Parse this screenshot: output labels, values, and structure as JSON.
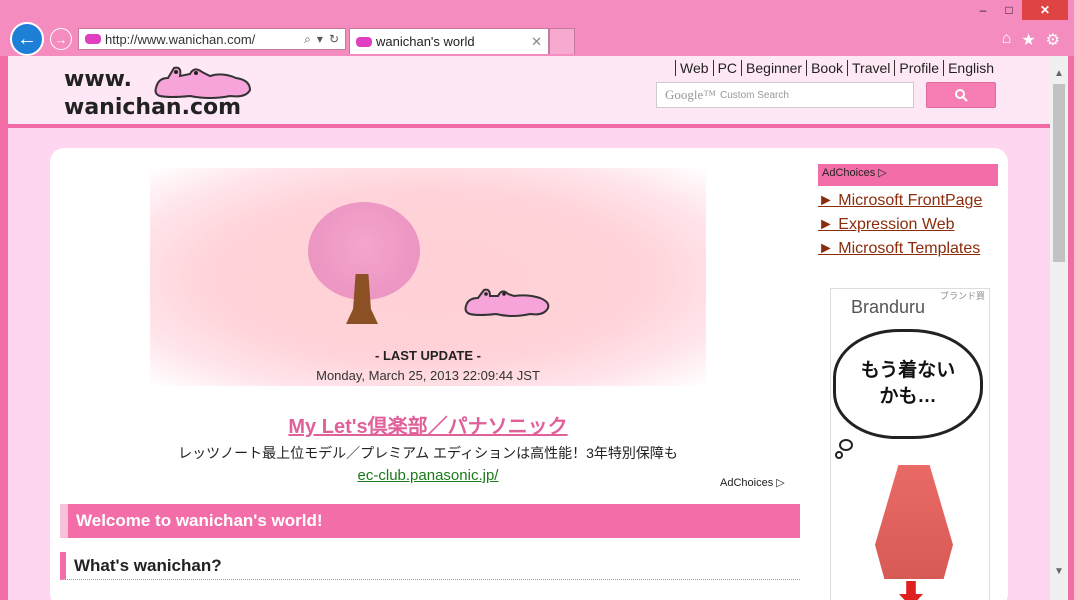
{
  "browser": {
    "address_url": "http://www.wanichan.com/",
    "tab_title": "wanichan's world",
    "window_buttons": [
      "–",
      "□",
      "✕"
    ],
    "right_icons": [
      "home-icon",
      "star-icon",
      "gear-icon"
    ]
  },
  "site": {
    "logo_line1": "www.",
    "logo_line2": "wanichan.com",
    "nav": [
      "Web",
      "PC",
      "Beginner",
      "Book",
      "Travel",
      "Profile",
      "English"
    ],
    "search_brand": "Google™",
    "search_placeholder": "Custom Search"
  },
  "hero": {
    "last_update_label": "- LAST UPDATE -",
    "last_update_date": "Monday, March 25, 2013 22:09:44 JST"
  },
  "main_ad": {
    "title": "My Let's倶楽部／パナソニック",
    "description": "レッツノート最上位モデル／プレミアム エディションは高性能！3年特別保障も",
    "url": "ec-club.panasonic.jp/",
    "adchoices": "AdChoices"
  },
  "sections": {
    "welcome": "Welcome to wanichan's world!",
    "whats": "What's wanichan?"
  },
  "sidebar": {
    "adchoices": "AdChoices",
    "links": [
      "► Microsoft FrontPage",
      "► Expression Web",
      "► Microsoft Templates"
    ],
    "banner": {
      "brand": "Branduru",
      "brand_jp": "ブランド買",
      "bubble_line1": "もう着ない",
      "bubble_line2": "かも…"
    }
  },
  "colors": {
    "accent_pink": "#f36ea8",
    "chrome_pink": "#f58cc0",
    "page_bg": "#ffd6ef",
    "link_brown": "#8b2d0c",
    "ad_green": "#1a7a1a"
  }
}
